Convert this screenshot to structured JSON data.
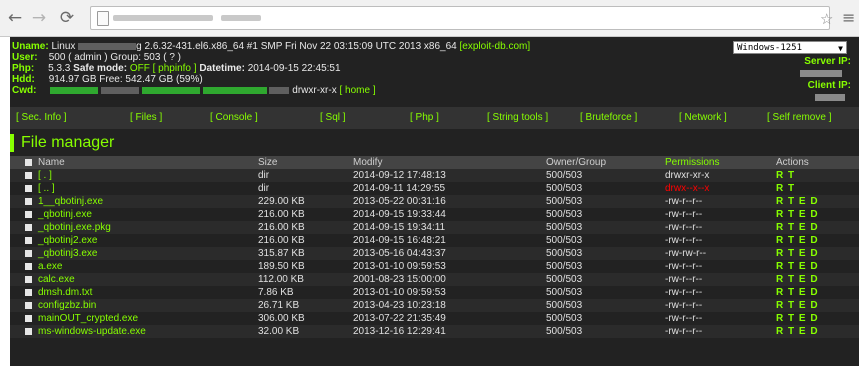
{
  "browser": {
    "back_icon": "arrow-left-icon",
    "forward_icon": "arrow-right-icon",
    "reload_icon": "reload-icon",
    "star_icon": "star-icon",
    "menu_icon": "hamburger-menu-icon"
  },
  "header": {
    "uname_label": "Uname:",
    "uname_prefix": "Linux",
    "uname_value": "g 2.6.32-431.el6.x86_64 #1 SMP Fri Nov 22 03:15:09 UTC 2013 x86_64",
    "uname_link": "[exploit-db.com]",
    "user_label": "User:",
    "user_value": "500 ( admin ) Group: 503 ( ? )",
    "php_label": "Php:",
    "php_value": "5.3.3",
    "safe_mode_label": "Safe mode:",
    "safe_mode_value": "OFF",
    "phpinfo_link": "[ phpinfo ]",
    "datetime_label": "Datetime:",
    "datetime_value": "2014-09-15 22:45:51",
    "hdd_label": "Hdd:",
    "hdd_value": "914.97 GB Free: 542.47 GB (59%)",
    "cwd_label": "Cwd:",
    "cwd_perm": "drwxr-xr-x",
    "cwd_home": "[ home ]",
    "charset_select": "Windows-1251",
    "server_ip_label": "Server IP:",
    "client_ip_label": "Client IP:"
  },
  "nav": {
    "items": [
      "[ Sec. Info ]",
      "[ Files ]",
      "[ Console ]",
      "[ Sql ]",
      "[ Php ]",
      "[ String tools ]",
      "[ Bruteforce ]",
      "[ Network ]",
      "[ Self remove ]"
    ]
  },
  "file_manager": {
    "title": "File manager",
    "columns": {
      "name": "Name",
      "size": "Size",
      "modify": "Modify",
      "owner": "Owner/Group",
      "permissions": "Permissions",
      "actions": "Actions"
    },
    "rows": [
      {
        "name": "[ . ]",
        "size": "dir",
        "modify": "2014-09-12 17:48:13",
        "owner": "500/503",
        "perm": "drwxr-xr-x",
        "actions": "R T"
      },
      {
        "name": "[ .. ]",
        "size": "dir",
        "modify": "2014-09-11 14:29:55",
        "owner": "500/503",
        "perm": "drwx--x--x",
        "actions": "R T"
      },
      {
        "name": "1__qbotinj.exe",
        "size": "229.00 KB",
        "modify": "2013-05-22 00:31:16",
        "owner": "500/503",
        "perm": "-rw-r--r--",
        "actions": "R T E D"
      },
      {
        "name": "_qbotinj.exe",
        "size": "216.00 KB",
        "modify": "2014-09-15 19:33:44",
        "owner": "500/503",
        "perm": "-rw-r--r--",
        "actions": "R T E D"
      },
      {
        "name": "_qbotinj.exe.pkg",
        "size": "216.00 KB",
        "modify": "2014-09-15 19:34:11",
        "owner": "500/503",
        "perm": "-rw-r--r--",
        "actions": "R T E D"
      },
      {
        "name": "_qbotinj2.exe",
        "size": "216.00 KB",
        "modify": "2014-09-15 16:48:21",
        "owner": "500/503",
        "perm": "-rw-r--r--",
        "actions": "R T E D"
      },
      {
        "name": "_qbotinj3.exe",
        "size": "315.87 KB",
        "modify": "2013-05-16 04:43:37",
        "owner": "500/503",
        "perm": "-rw-rw-r--",
        "actions": "R T E D"
      },
      {
        "name": "a.exe",
        "size": "189.50 KB",
        "modify": "2013-01-10 09:59:53",
        "owner": "500/503",
        "perm": "-rw-r--r--",
        "actions": "R T E D"
      },
      {
        "name": "calc.exe",
        "size": "112.00 KB",
        "modify": "2001-08-23 15:00:00",
        "owner": "500/503",
        "perm": "-rw-r--r--",
        "actions": "R T E D"
      },
      {
        "name": "dmsh.dm.txt",
        "size": "7.86 KB",
        "modify": "2013-01-10 09:59:53",
        "owner": "500/503",
        "perm": "-rw-r--r--",
        "actions": "R T E D"
      },
      {
        "name": "configzbz.bin",
        "size": "26.71 KB",
        "modify": "2013-04-23 10:23:18",
        "owner": "500/503",
        "perm": "-rw-r--r--",
        "actions": "R T E D"
      },
      {
        "name": "mainOUT_crypted.exe",
        "size": "306.00 KB",
        "modify": "2013-07-22 21:35:49",
        "owner": "500/503",
        "perm": "-rw-r--r--",
        "actions": "R T E D"
      },
      {
        "name": "ms-windows-update.exe",
        "size": "32.00 KB",
        "modify": "2013-12-16 12:29:41",
        "owner": "500/503",
        "perm": "-rw-r--r--",
        "actions": "R T E D"
      }
    ]
  },
  "colors": {
    "accent": "#87ff00",
    "background": "#222222",
    "warning": "#ff0000"
  }
}
